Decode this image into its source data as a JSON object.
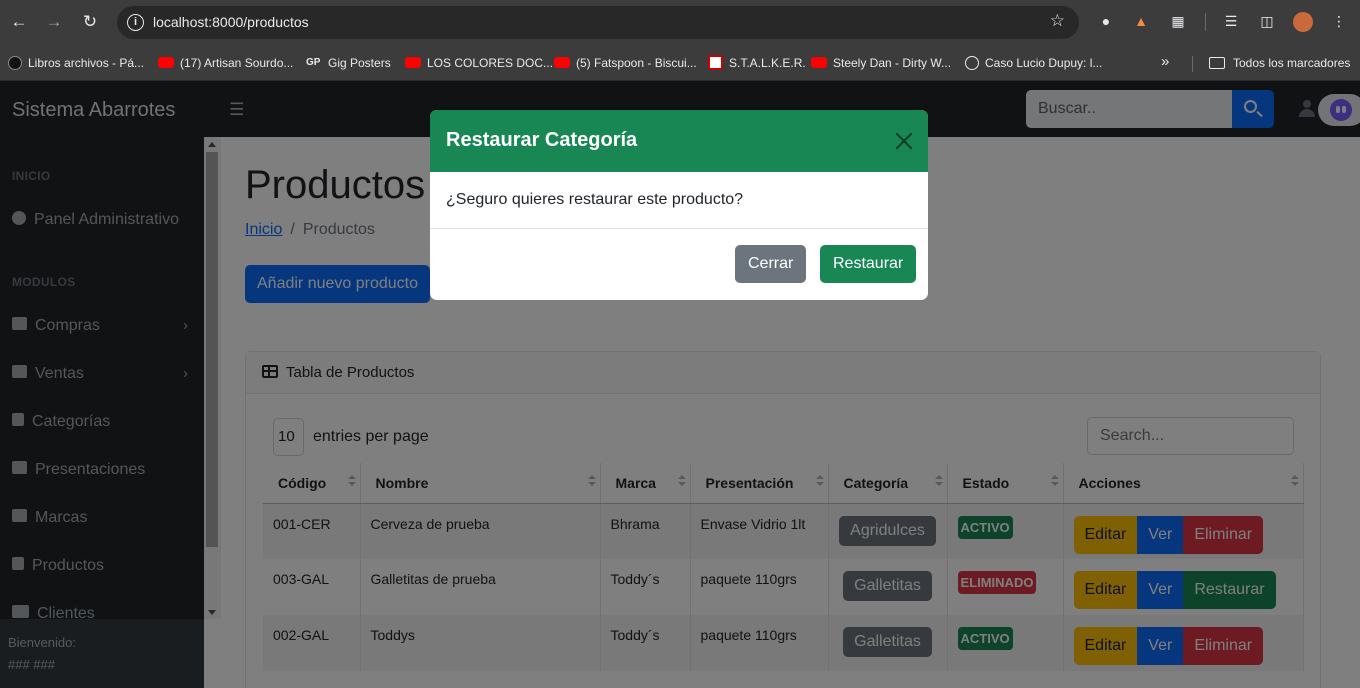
{
  "browser": {
    "url": "localhost:8000/productos",
    "bookmarks": [
      {
        "label": "Libros archivos - Pá..."
      },
      {
        "label": "(17) Artisan Sourdo..."
      },
      {
        "label": "Gig Posters"
      },
      {
        "label": "LOS COLORES DOC..."
      },
      {
        "label": "(5) Fatspoon - Biscui..."
      },
      {
        "label": "S.T.A.L.K.E.R."
      },
      {
        "label": "Steely Dan - Dirty W..."
      },
      {
        "label": "Caso Lucio Dupuy: l..."
      }
    ],
    "all_bookmarks": "Todos los marcadores"
  },
  "app": {
    "brand": "Sistema Abarrotes",
    "search_placeholder": "Buscar.."
  },
  "sidebar": {
    "heading_inicio": "INICIO",
    "heading_modulos": "MODULOS",
    "items": [
      {
        "label": "Panel Administrativo"
      },
      {
        "label": "Compras"
      },
      {
        "label": "Ventas"
      },
      {
        "label": "Categorías"
      },
      {
        "label": "Presentaciones"
      },
      {
        "label": "Marcas"
      },
      {
        "label": "Productos"
      },
      {
        "label": "Clientes"
      }
    ],
    "footer_welcome": "Bienvenido:",
    "footer_user": "### ###"
  },
  "main": {
    "title": "Productos",
    "breadcrumb_home": "Inicio",
    "breadcrumb_sep": "/",
    "breadcrumb_current": "Productos",
    "add_button": "Añadir nuevo producto",
    "card_title": "Tabla de Productos",
    "per_page_value": "10",
    "per_page_label": "entries per page",
    "search_placeholder": "Search...",
    "columns": [
      "Código",
      "Nombre",
      "Marca",
      "Presentación",
      "Categoría",
      "Estado",
      "Acciones"
    ],
    "rows": [
      {
        "codigo": "001-CER",
        "nombre": "Cerveza de prueba",
        "marca": "Bhrama",
        "presentacion": "Envase Vidrio 1lt",
        "categoria": "Agridulces",
        "estado": "ACTIVO",
        "accion": "Eliminar"
      },
      {
        "codigo": "003-GAL",
        "nombre": "Galletitas de prueba",
        "marca": "Toddy´s",
        "presentacion": "paquete 110grs",
        "categoria": "Galletitas",
        "estado": "ELIMINADO",
        "accion": "Restaurar"
      },
      {
        "codigo": "002-GAL",
        "nombre": "Toddys",
        "marca": "Toddy´s",
        "presentacion": "paquete 110grs",
        "categoria": "Galletitas",
        "estado": "ACTIVO",
        "accion": "Eliminar"
      }
    ],
    "btn_editar": "Editar",
    "btn_ver": "Ver"
  },
  "modal": {
    "title": "Restaurar Categoría",
    "message": "¿Seguro quieres restaurar este producto?",
    "cancel": "Cerrar",
    "confirm": "Restaurar"
  }
}
